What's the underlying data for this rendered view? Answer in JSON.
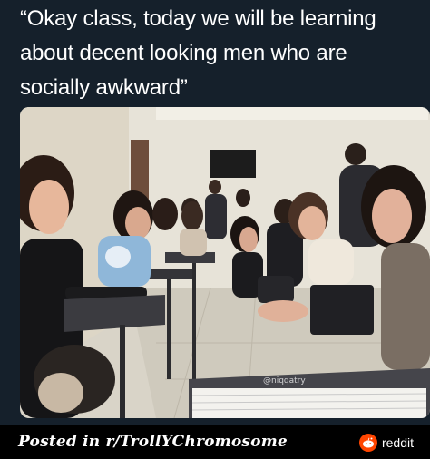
{
  "caption": {
    "lines": [
      "“Okay class, today we will be learning",
      "about decent looking men who are",
      "socially awkward”"
    ]
  },
  "photo": {
    "watermark": "@niqqatry"
  },
  "footer": {
    "posted_text": "Posted in r/TrollYChromosome",
    "brand_label": "reddit",
    "brand_color": "#ff4500"
  },
  "colors": {
    "background": "#15202b",
    "text": "#ffffff"
  }
}
